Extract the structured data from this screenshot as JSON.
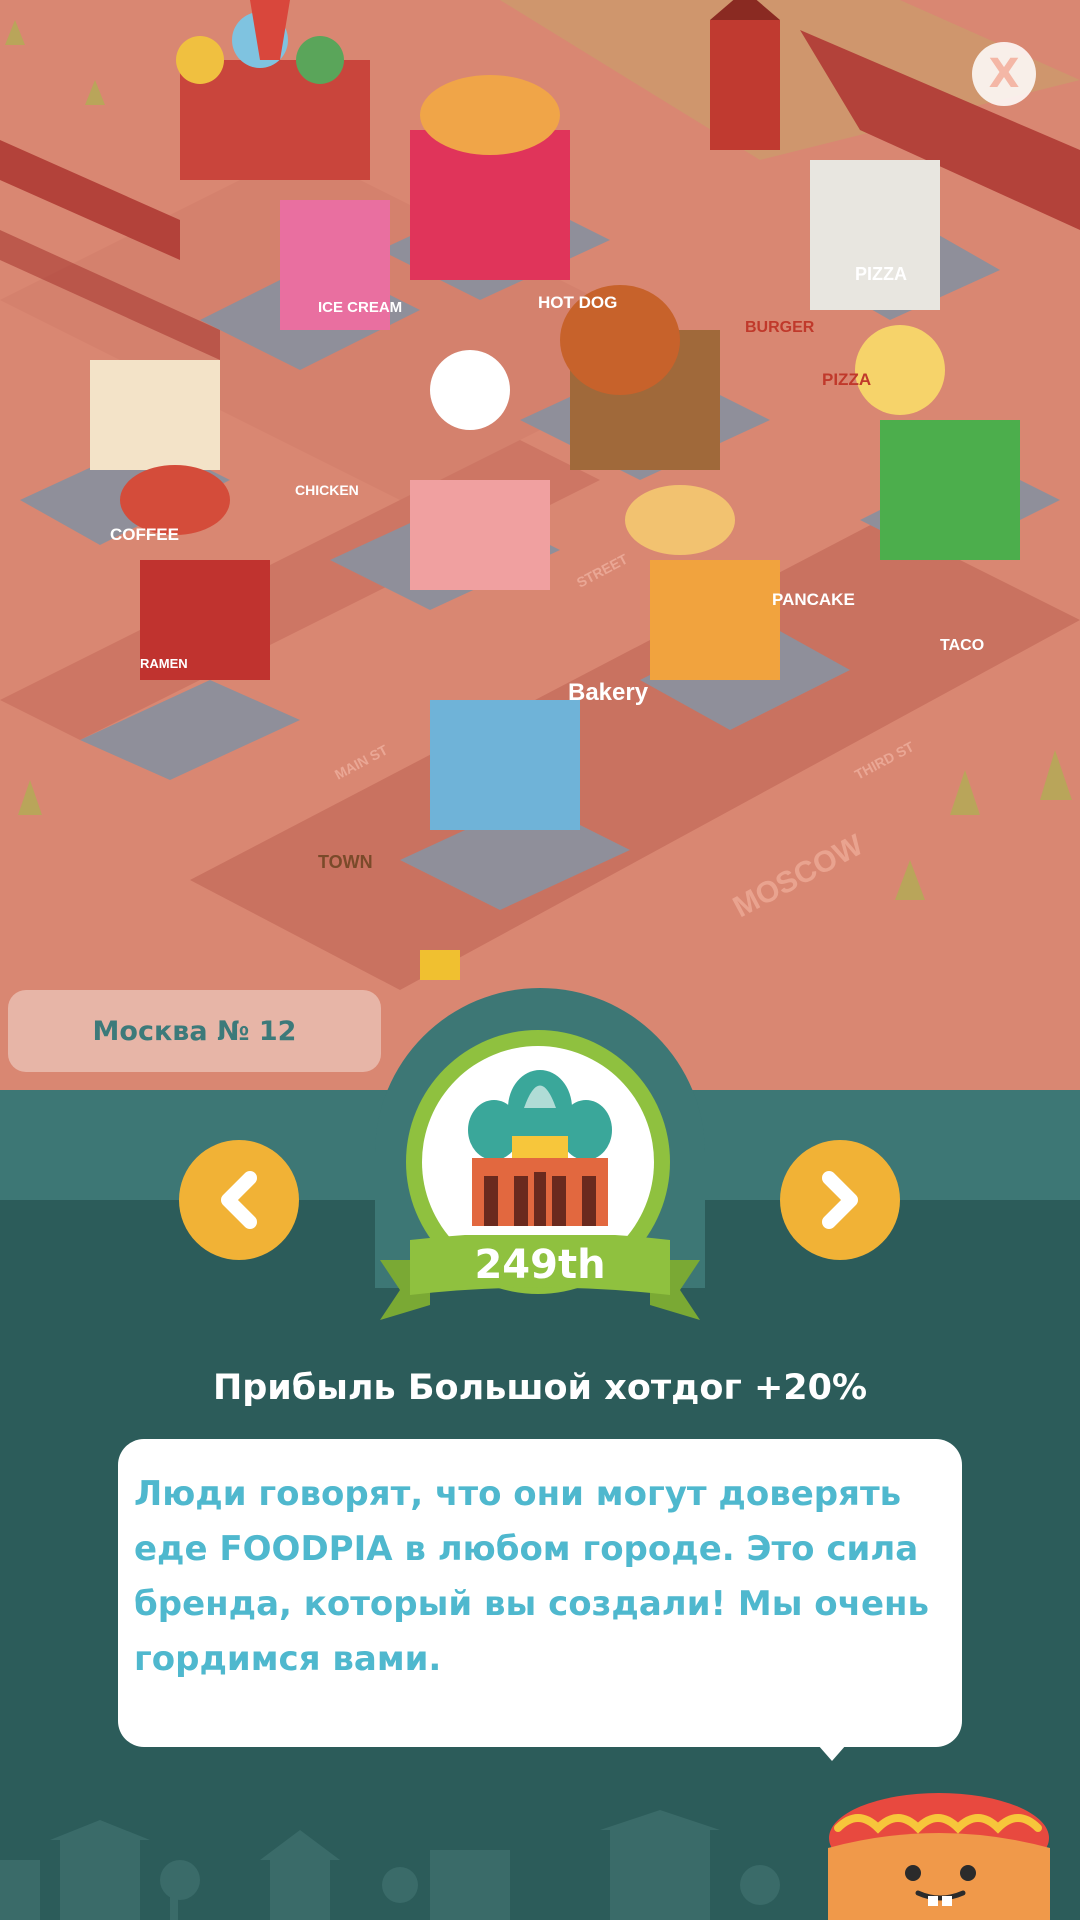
{
  "map": {
    "signs": {
      "coffee": "COFFEE",
      "ice_cream": "ICE CREAM",
      "hot_dog": "HOT DOG",
      "burger": "BURGER",
      "pizza": "PIZZA",
      "pizza2": "PIZZA",
      "chicken": "CHICKEN",
      "pancake": "PANCAKE",
      "taco": "TACO",
      "bakery": "Bakery",
      "ramen": "RAMEN",
      "town": "TOWN",
      "moscow": "MOSCOW",
      "street": "STREET",
      "main_st": "MAIN ST",
      "third_st": "THIRD ST"
    }
  },
  "close_label": "X",
  "city_label": "Москва № 12",
  "medal": {
    "rank": "249th",
    "icon": "cathedral-icon"
  },
  "nav": {
    "prev_icon": "chevron-left-icon",
    "next_icon": "chevron-right-icon"
  },
  "bonus_text": "Прибыль Большой хотдог +20%",
  "message": "Люди говорят, что они могут доверять еде FOODPIA в любом городе. Это сила бренда, который вы создали! Мы очень гордимся вами.",
  "colors": {
    "accent_green": "#8fc13f",
    "arrow_yellow": "#f1b236",
    "panel_teal": "#2c5c5a",
    "message_blue": "#4fb8ce"
  }
}
